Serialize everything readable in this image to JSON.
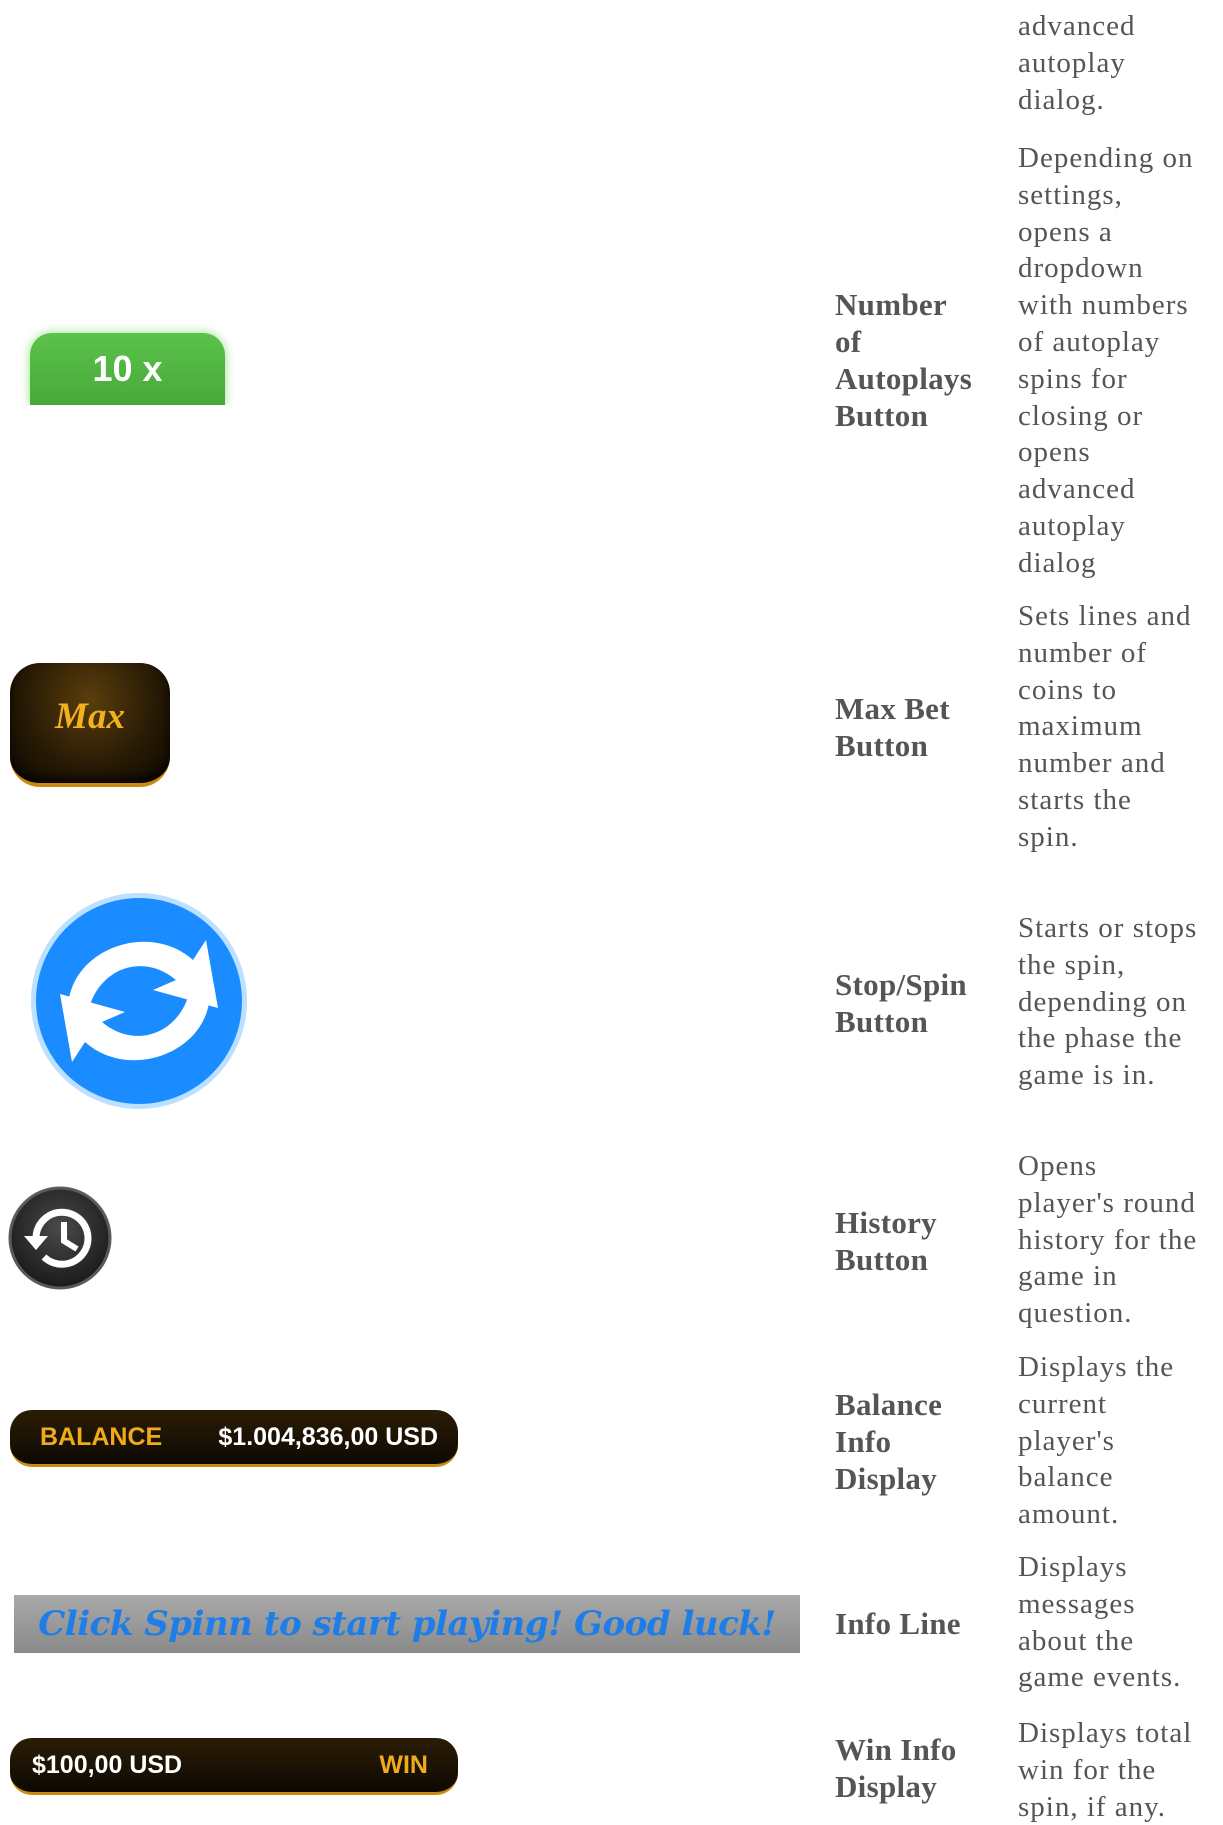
{
  "rows": [
    {
      "desc_lines": [
        "advanced",
        "autoplay",
        "dialog."
      ]
    },
    {
      "name_lines": [
        "Number",
        "of",
        "Autoplays",
        "Button"
      ],
      "desc_lines": [
        "Depending on",
        "settings,",
        "opens a",
        "dropdown",
        "with numbers",
        "of autoplay",
        "spins for",
        "closing or",
        "opens",
        "advanced",
        "autoplay",
        "dialog"
      ],
      "image": {
        "label": "10 x",
        "color": "#4caf3f"
      }
    },
    {
      "name_lines": [
        "Max Bet",
        "Button"
      ],
      "desc_lines": [
        "Sets lines and",
        "number of",
        "coins to",
        "maximum",
        "number and",
        "starts the",
        "spin."
      ],
      "image": {
        "label": "Max",
        "color": "#f2b21e"
      }
    },
    {
      "name_lines": [
        "Stop/Spin",
        "Button"
      ],
      "desc_lines": [
        "Starts or stops",
        "the spin,",
        "depending on",
        "the phase the",
        "game is in."
      ],
      "image": {
        "icon": "spin-arrows-icon",
        "color": "#1a8cff"
      }
    },
    {
      "name_lines": [
        "History",
        "Button"
      ],
      "desc_lines": [
        "Opens",
        "player's round",
        "history for the",
        "game in",
        "question."
      ],
      "image": {
        "icon": "history-icon"
      }
    },
    {
      "name_lines": [
        "Balance",
        "Info",
        "Display"
      ],
      "desc_lines": [
        "Displays the",
        "current",
        "player's",
        "balance",
        "amount."
      ],
      "image": {
        "label": "BALANCE",
        "value": "$1.004,836,00 USD"
      }
    },
    {
      "name_lines": [
        "Info Line"
      ],
      "desc_lines": [
        "Displays",
        "messages",
        "about the",
        "game events."
      ],
      "image": {
        "message": "Click Spinn to start playing! Good luck!",
        "color": "#1e7de6"
      }
    },
    {
      "name_lines": [
        "Win Info",
        "Display"
      ],
      "desc_lines": [
        "Displays total",
        "win for the",
        "spin, if any."
      ],
      "image": {
        "value": "$100,00 USD",
        "label": "WIN"
      }
    }
  ]
}
